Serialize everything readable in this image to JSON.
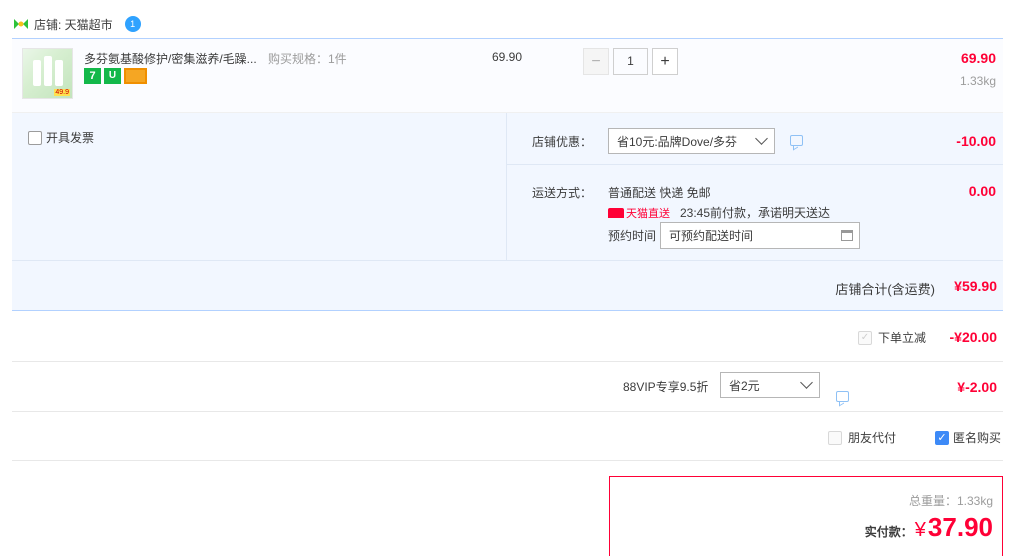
{
  "shop": {
    "label": "店铺: 天猫超市",
    "wangwang": "1"
  },
  "item": {
    "title": "多芬氨基酸修护/密集滋养/毛躁...",
    "spec": "购买规格：1件",
    "thumb_price": "49.9",
    "tags": [
      "7",
      "U",
      ""
    ],
    "unit_price": "69.90",
    "quantity": "1",
    "minus": "−",
    "plus": "+",
    "total": "69.90",
    "weight": "1.33kg"
  },
  "invoice": {
    "label": "开具发票"
  },
  "shop_discount": {
    "label": "店铺优惠：",
    "selected": "省10元:品牌Dove/多芬",
    "amount": "-10.00"
  },
  "shipping": {
    "label": "运送方式：",
    "method": "普通配送 快递 免邮",
    "amount": "0.00",
    "badge": "天猫直送",
    "promise": "23:45前付款，承诺明天送达",
    "schedule_label": "预约时间",
    "schedule_placeholder": "可预约配送时间"
  },
  "shop_total": {
    "label": "店铺合计(含运费)",
    "value": "¥59.90"
  },
  "instant_discount": {
    "check": "✓",
    "label": "下单立减",
    "value": "-¥20.00"
  },
  "vip": {
    "label": "88VIP专享9.5折",
    "selected": "省2元",
    "value": "¥-2.00"
  },
  "friend_pay": {
    "label": "朋友代付"
  },
  "anonymous": {
    "label": "匿名购买",
    "check": "✓"
  },
  "summary": {
    "weight": "总重量：1.33kg",
    "pay_label": "实付款：",
    "currency": "¥",
    "amount": "37.90"
  },
  "colors": {
    "accent_red": "#ff0036",
    "blue_border": "#b2d1ff",
    "panel_bg": "#f2f7ff"
  }
}
